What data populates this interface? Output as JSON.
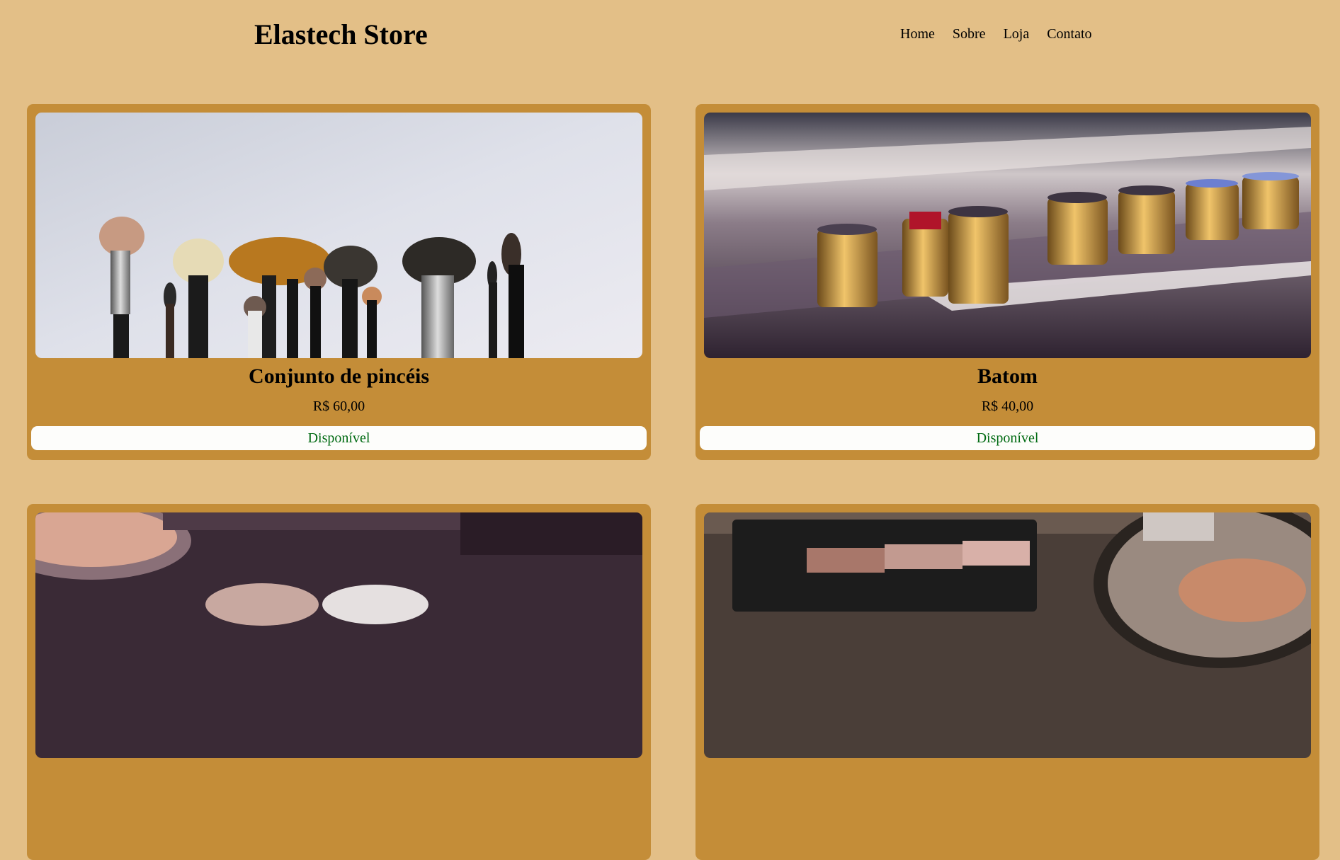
{
  "header": {
    "brand": "Elastech Store",
    "nav": [
      "Home",
      "Sobre",
      "Loja",
      "Contato"
    ]
  },
  "products": [
    {
      "title": "Conjunto de pincéis",
      "price": "R$ 60,00",
      "status": "Disponível",
      "image": "makeup-brushes-photo"
    },
    {
      "title": "Batom",
      "price": "R$ 40,00",
      "status": "Disponível",
      "image": "lipsticks-photo"
    },
    {
      "image": "powder-jars-photo"
    },
    {
      "image": "eyeshadow-palette-photo"
    }
  ],
  "colors": {
    "page_background": "#e3bf87",
    "card_background": "#c48d38",
    "status_text": "#006a12",
    "status_background": "#fdfdfb"
  }
}
